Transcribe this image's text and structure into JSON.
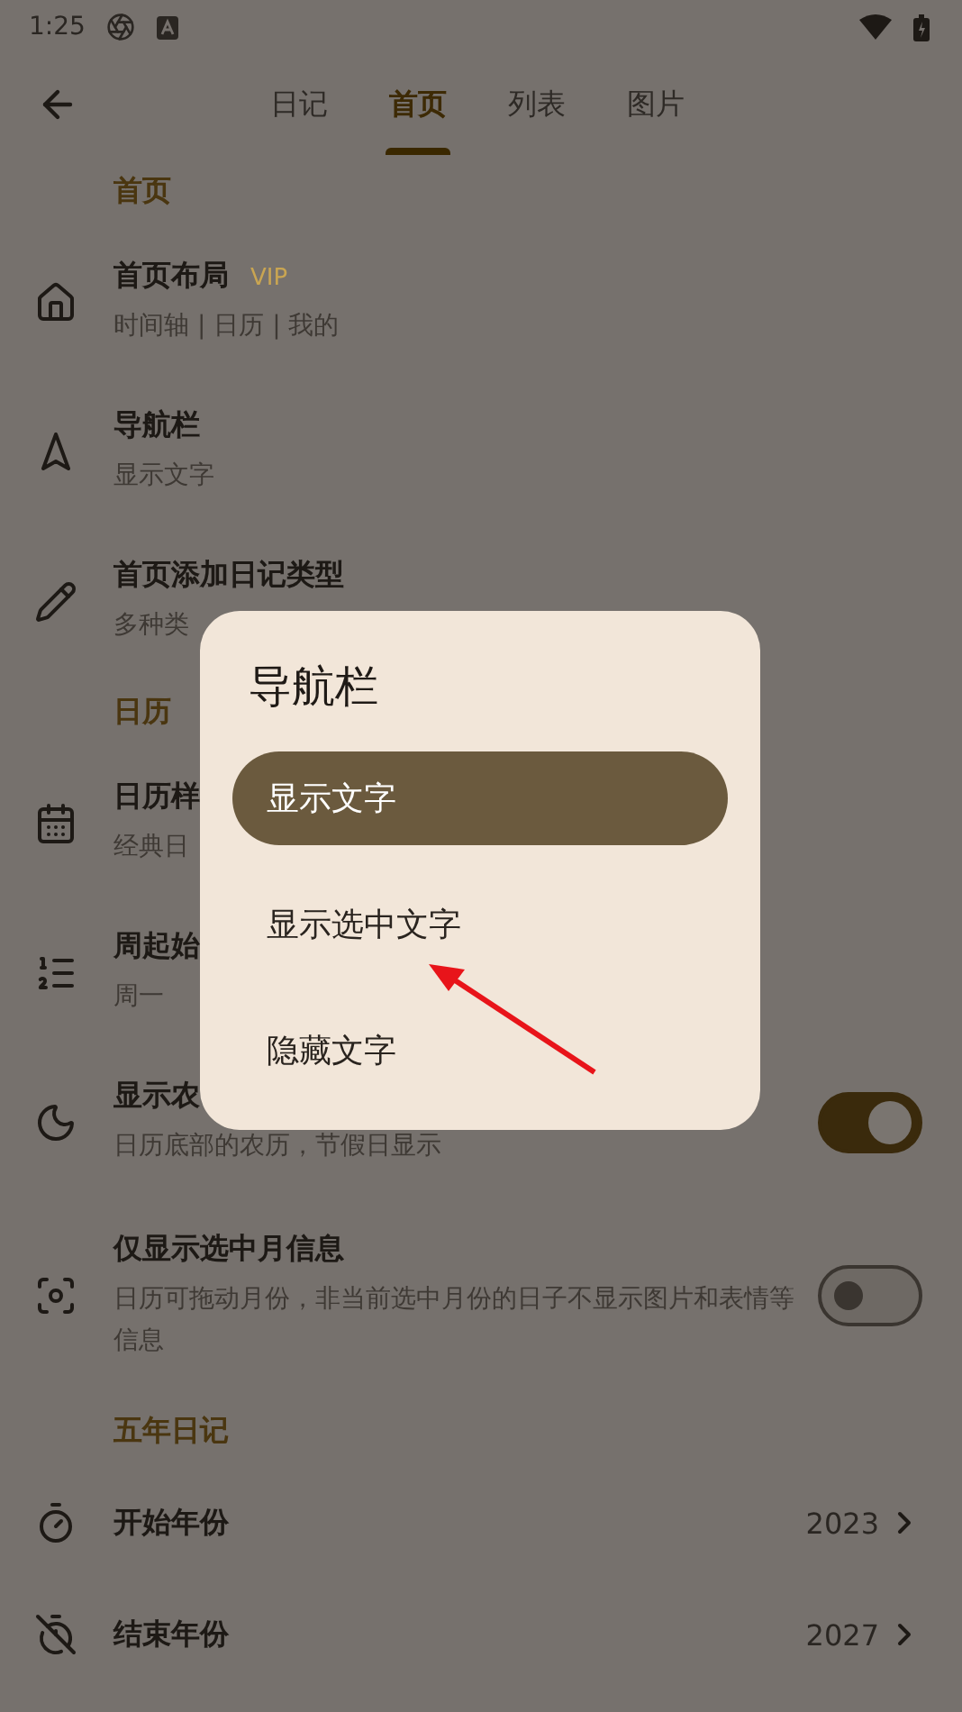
{
  "status_bar": {
    "time": "1:25"
  },
  "tabs": [
    {
      "label": "日记",
      "selected": false
    },
    {
      "label": "首页",
      "selected": true
    },
    {
      "label": "列表",
      "selected": false
    },
    {
      "label": "图片",
      "selected": false
    }
  ],
  "sections": [
    {
      "title": "首页",
      "items": [
        {
          "kind": "nav",
          "title": "首页布局",
          "badge": "VIP",
          "subtitle": "时间轴 | 日历 | 我的"
        },
        {
          "kind": "nav",
          "title": "导航栏",
          "subtitle": "显示文字"
        },
        {
          "kind": "nav",
          "title": "首页添加日记类型",
          "subtitle": "多种类"
        }
      ]
    },
    {
      "title": "日历",
      "items": [
        {
          "kind": "nav",
          "title": "日历样",
          "subtitle": "经典日"
        },
        {
          "kind": "nav",
          "title": "周起始",
          "subtitle": "周一"
        },
        {
          "kind": "toggle",
          "title": "显示农",
          "subtitle": "日历底部的农历，节假日显示",
          "on": true
        },
        {
          "kind": "toggle",
          "title": "仅显示选中月信息",
          "subtitle": "日历可拖动月份，非当前选中月份的日子不显示图片和表情等信息",
          "on": false
        }
      ]
    },
    {
      "title": "五年日记",
      "items": [
        {
          "kind": "value",
          "title": "开始年份",
          "value": "2023"
        },
        {
          "kind": "value",
          "title": "结束年份",
          "value": "2027"
        }
      ]
    }
  ],
  "dialog": {
    "title": "导航栏",
    "options": [
      {
        "label": "显示文字",
        "selected": true
      },
      {
        "label": "显示选中文字",
        "selected": false
      },
      {
        "label": "隐藏文字",
        "selected": false
      }
    ]
  }
}
